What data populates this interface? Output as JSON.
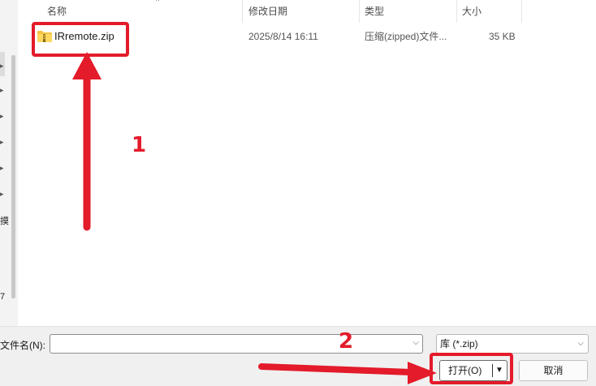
{
  "columns": {
    "name": "名称",
    "modified": "修改日期",
    "type": "类型",
    "size": "大小"
  },
  "files": [
    {
      "name": "IRremote.zip",
      "modified": "2025/8/14 16:11",
      "type": "压缩(zipped)文件...",
      "size": "35 KB",
      "icon": "zip-folder-icon"
    }
  ],
  "nav_fragments": {
    "a": "摸",
    "b": "7"
  },
  "footer": {
    "filename_label": "文件名(N):",
    "filename_value": "",
    "filetype_value": "库 (*.zip)",
    "open_label": "打开(O)",
    "cancel_label": "取消"
  },
  "annotations": {
    "step1": "1",
    "step2": "2",
    "color": "#e31b2a"
  }
}
